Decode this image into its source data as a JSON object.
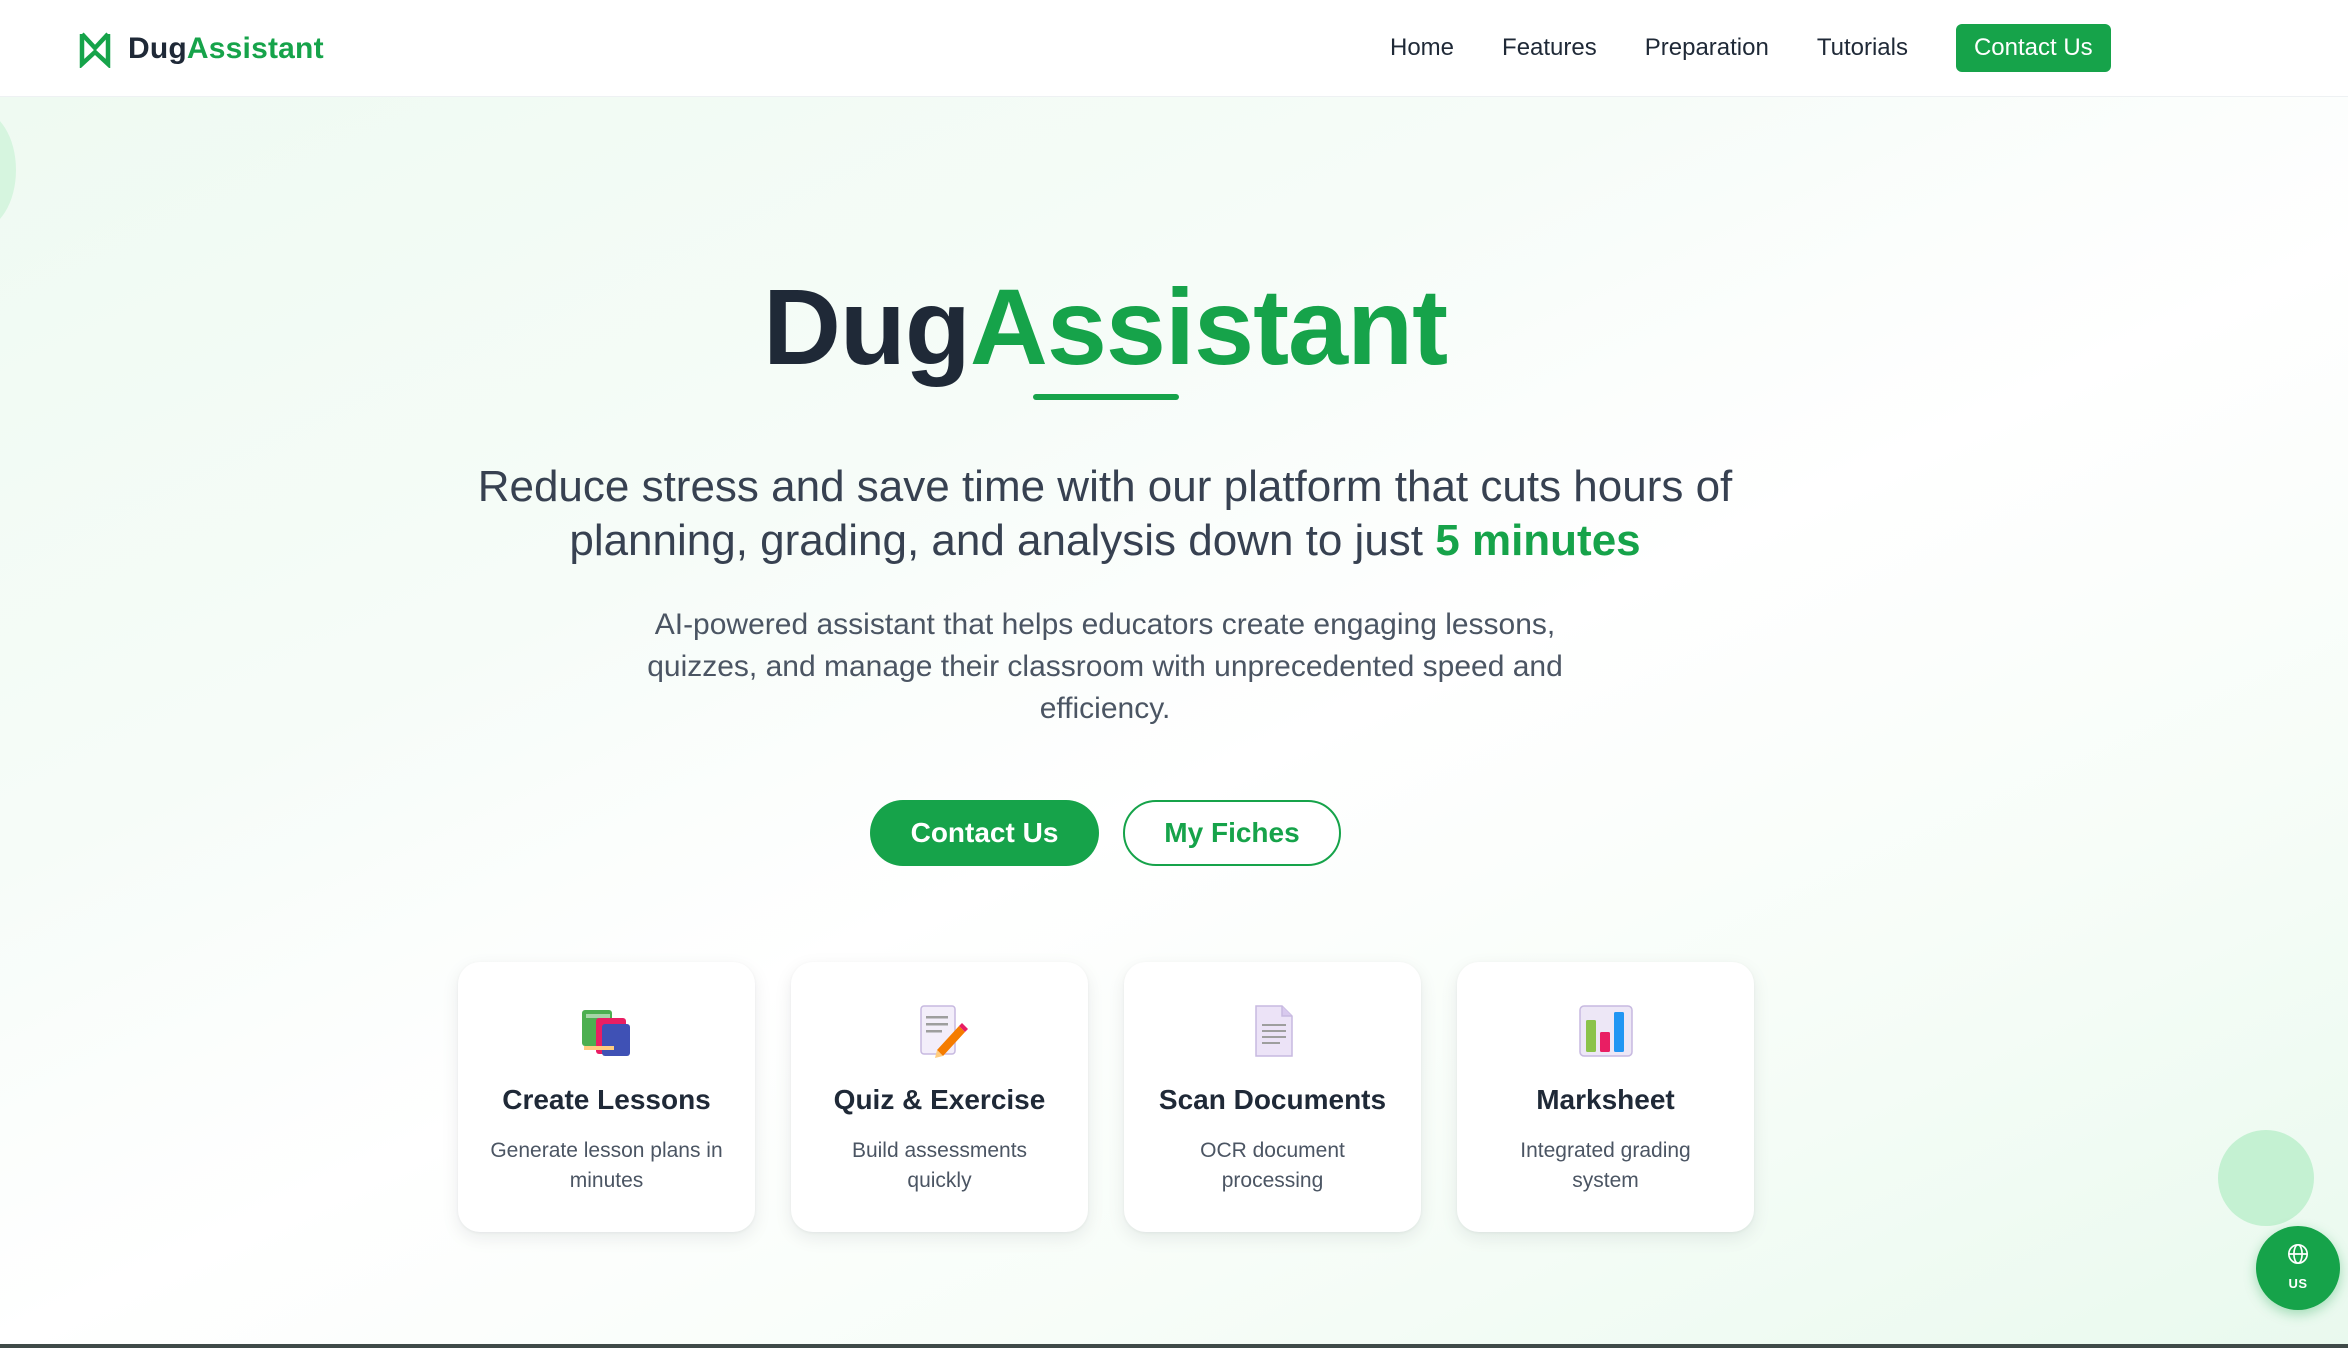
{
  "header": {
    "brand": {
      "part1": "Dug",
      "part2": "Assistant",
      "logo_icon": "bookmark-logo-icon"
    },
    "nav": [
      "Home",
      "Features",
      "Preparation",
      "Tutorials"
    ],
    "cta_label": "Contact Us"
  },
  "hero": {
    "title_part1": "Dug",
    "title_part2": "Assistant",
    "subtitle_main": "Reduce stress and save time with our platform that cuts hours of planning, grading, and analysis down to just ",
    "subtitle_highlight": "5 minutes",
    "description": "AI-powered assistant that helps educators create engaging lessons, quizzes, and manage their classroom with unprecedented speed and efficiency.",
    "primary_button": "Contact Us",
    "secondary_button": "My Fiches"
  },
  "features": [
    {
      "icon": "books-icon",
      "title": "Create Lessons",
      "description": "Generate lesson plans in minutes"
    },
    {
      "icon": "memo-pencil-icon",
      "title": "Quiz & Exercise",
      "description": "Build assessments quickly"
    },
    {
      "icon": "document-icon",
      "title": "Scan Documents",
      "description": "OCR document processing"
    },
    {
      "icon": "bar-chart-icon",
      "title": "Marksheet",
      "description": "Integrated grading system"
    }
  ],
  "language_button": {
    "icon": "globe-icon",
    "code": "US"
  },
  "colors": {
    "brand_green": "#16a34a",
    "text_dark": "#1f2937",
    "text_muted": "#4b5563",
    "background_tint": "#eefaf1"
  }
}
